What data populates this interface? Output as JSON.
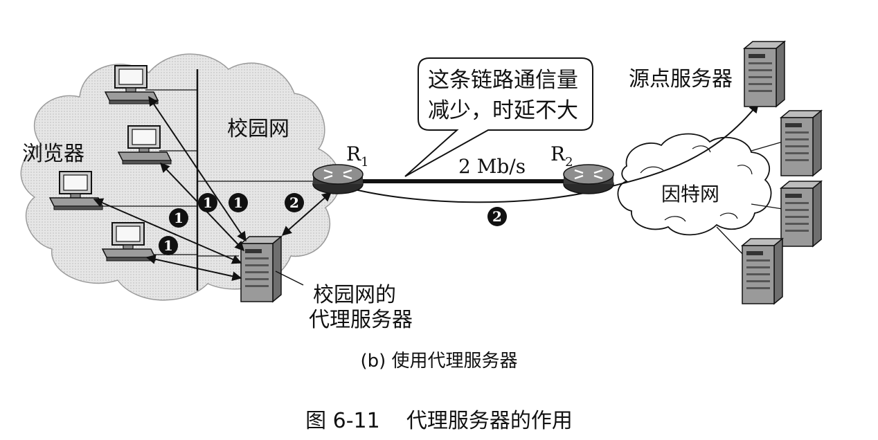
{
  "labels": {
    "browser": "浏览器",
    "campus_net": "校园网",
    "proxy_line1": "校园网的",
    "proxy_line2": "代理服务器",
    "router1": "R",
    "router1_sub": "1",
    "router2": "R",
    "router2_sub": "2",
    "link_speed": "2 Mb/s",
    "internet": "因特网",
    "origin_server": "源点服务器",
    "callout_line1": "这条链路通信量",
    "callout_line2": "减少，时延不大",
    "subcaption": "(b) 使用代理服务器",
    "figure_caption": "图 6-11    代理服务器的作用"
  },
  "markers": {
    "one": "1",
    "two": "2"
  },
  "colors": {
    "ink": "#111111",
    "cloud_fill": "#d9d9d9",
    "background": "#ffffff"
  }
}
